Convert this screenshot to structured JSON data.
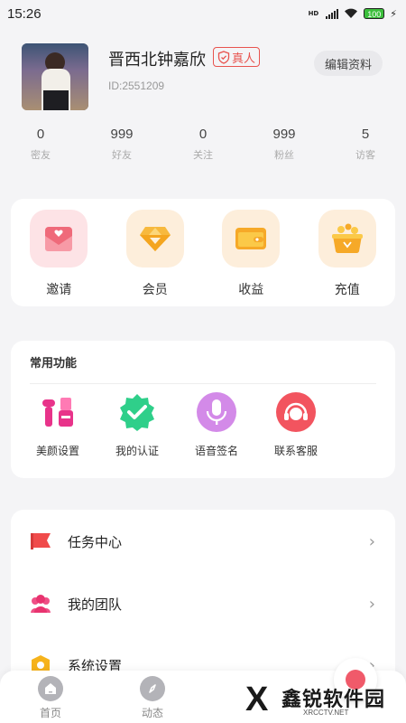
{
  "status_bar": {
    "time": "15:26",
    "network": "HD",
    "battery": "100"
  },
  "profile": {
    "nickname": "晋西北钟嘉欣",
    "verify_badge": "真人",
    "user_id": "ID:2551209",
    "edit_button": "编辑资料"
  },
  "stats": [
    {
      "value": "0",
      "label": "密友"
    },
    {
      "value": "999",
      "label": "好友"
    },
    {
      "value": "0",
      "label": "关注"
    },
    {
      "value": "999",
      "label": "粉丝"
    },
    {
      "value": "5",
      "label": "访客"
    }
  ],
  "top_actions": [
    {
      "label": "邀请",
      "icon": "invite-envelope-icon"
    },
    {
      "label": "会员",
      "icon": "vip-diamond-icon"
    },
    {
      "label": "收益",
      "icon": "wallet-icon"
    },
    {
      "label": "充值",
      "icon": "coin-pot-icon"
    }
  ],
  "common_functions": {
    "title": "常用功能",
    "items": [
      {
        "label": "美颜设置",
        "icon": "beauty-cosmetics-icon"
      },
      {
        "label": "我的认证",
        "icon": "verified-badge-icon"
      },
      {
        "label": "语音签名",
        "icon": "microphone-icon"
      },
      {
        "label": "联系客服",
        "icon": "headset-support-icon"
      }
    ]
  },
  "menu_list": [
    {
      "label": "任务中心",
      "icon": "flag-icon"
    },
    {
      "label": "我的团队",
      "icon": "team-icon"
    },
    {
      "label": "系统设置",
      "icon": "settings-icon"
    }
  ],
  "tabbar": [
    {
      "label": "首页",
      "icon": "home-icon"
    },
    {
      "label": "动态",
      "icon": "compass-icon"
    }
  ],
  "watermark": {
    "mark": "X",
    "text": "鑫锐软件园",
    "sub": "XRCCTV.NET"
  },
  "colors": {
    "accent_red": "#e8534e",
    "background": "#f4f4f6",
    "card": "#ffffff"
  }
}
